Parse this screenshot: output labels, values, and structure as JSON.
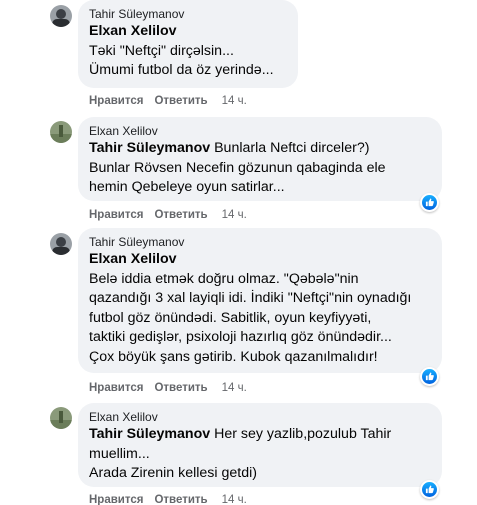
{
  "comments": [
    {
      "author": "Tahir Süleymanov",
      "mention": "Elxan Xelilov",
      "lines": [
        "Təki \"Neftçi\" dirçəlsin...",
        "Ümumi futbol da öz yerində..."
      ],
      "like_label": "Нравится",
      "reply_label": "Ответить",
      "time": "14 ч.",
      "has_reaction": false
    },
    {
      "author": "Elxan Xelilov",
      "mention": "Tahir Süleymanov",
      "lines": [
        " Bunlarla Neftci dirceler?)",
        "Bunlar Rövsen Necefin gözunun qabaginda ele",
        "hemin Qebeleye oyun satirlar..."
      ],
      "like_label": "Нравится",
      "reply_label": "Ответить",
      "time": "14 ч.",
      "has_reaction": true
    },
    {
      "author": "Tahir Süleymanov",
      "mention": "Elxan Xelilov",
      "lines": [
        "Belə iddia etmək doğru olmaz. \"Qəbələ\"nin",
        "qazandığı 3 xal layiqli idi. İndiki \"Neftçi\"nin oynadığı",
        "futbol göz önündədi. Sabitlik, oyun keyfiyyəti,",
        "taktiki gedişlər, psixoloji hazırlıq göz önündədir...",
        "Çox böyük şans gətirib. Kubok qazanılmalıdır!"
      ],
      "like_label": "Нравится",
      "reply_label": "Ответить",
      "time": "14 ч.",
      "has_reaction": true
    },
    {
      "author": "Elxan Xelilov",
      "mention": "Tahir Süleymanov",
      "lines": [
        " Her sey yazlib,pozulub Tahir",
        "muellim...",
        "Arada Zirenin kellesi getdi)"
      ],
      "like_label": "Нравится",
      "reply_label": "Ответить",
      "time": "14 ч.",
      "has_reaction": true
    }
  ],
  "icons": {
    "reaction": "like-reaction-icon",
    "avatar_tahir": "avatar-photo-tahir",
    "avatar_elxan": "avatar-photo-elxan"
  },
  "colors": {
    "bubble": "#f0f2f5",
    "meta": "#65676b",
    "reaction_blue": "#1877f2"
  }
}
